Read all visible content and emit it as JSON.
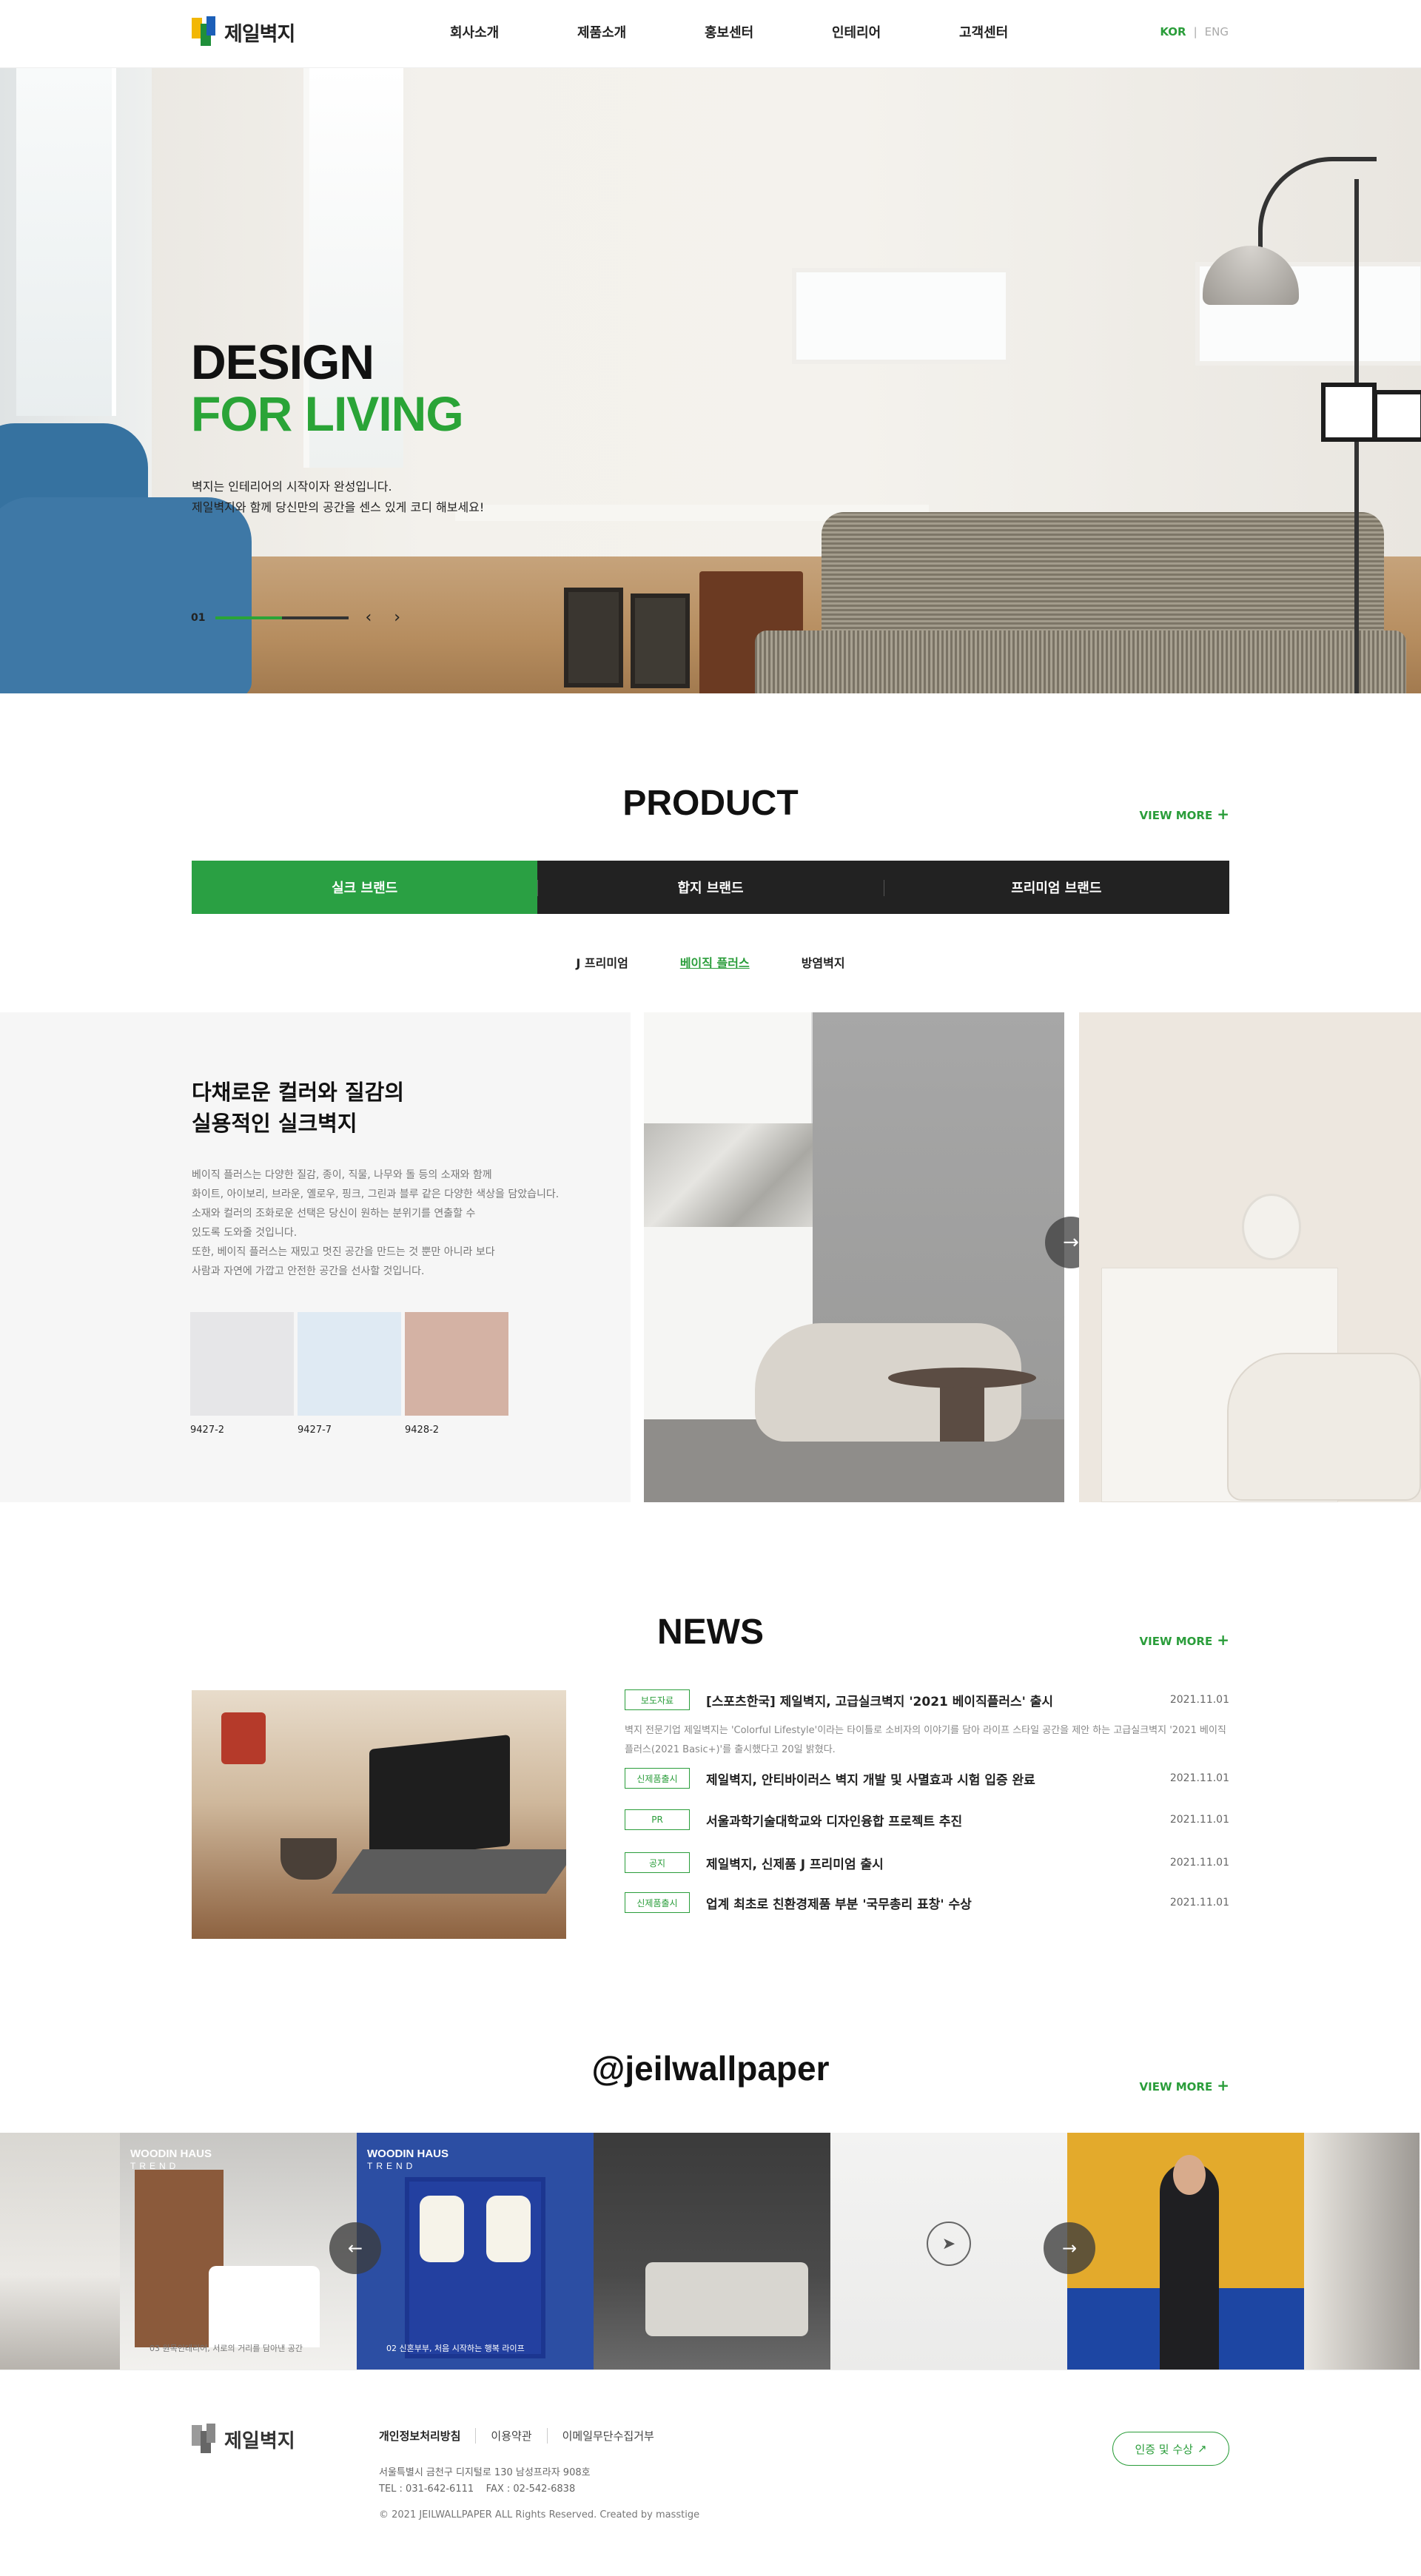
{
  "header": {
    "logo_text": "제일벽지",
    "nav": [
      "회사소개",
      "제품소개",
      "홍보센터",
      "인테리어",
      "고객센터"
    ],
    "lang_active": "KOR",
    "lang_other": "ENG"
  },
  "hero": {
    "title_line1": "DESIGN",
    "title_line2": "FOR LIVING",
    "desc_line1": "벽지는 인테리어의 시작이자 완성입니다.",
    "desc_line2": "제일벽지와 함께 당신만의 공간을 센스 있게 코디 해보세요!",
    "slide_number": "01",
    "progress": 0.5,
    "prev_icon": "‹",
    "next_icon": "›"
  },
  "product": {
    "title": "PRODUCT",
    "view_more": "VIEW MORE",
    "tabs": [
      "실크 브랜드",
      "합지 브랜드",
      "프리미엄 브랜드"
    ],
    "subtabs": [
      "J 프리미엄",
      "베이직 플러스",
      "방염벽지"
    ],
    "heading_line1": "다채로운 컬러와 질감의",
    "heading_line2": "실용적인 실크벽지",
    "desc": [
      "베이직 플러스는 다양한 질감, 종이, 직물, 나무와 돌 등의 소재와 함께",
      "화이트, 아이보리, 브라운, 옐로우, 핑크, 그린과 블루 같은 다양한 색상을 담았습니다.",
      "소재와 컬러의 조화로운 선택은 당신이 원하는 분위기를 연출할 수",
      "있도록 도와줄 것입니다.",
      "또한, 베이직 플러스는 재밌고 멋진 공간을 만드는 것 뿐만 아니라 보다",
      "사람과 자연에 가깝고 안전한 공간을 선사할 것입니다."
    ],
    "swatches": [
      {
        "code": "9427-2",
        "color": "#e6e6e8"
      },
      {
        "code": "9427-7",
        "color": "#dfeaf3"
      },
      {
        "code": "9428-2",
        "color": "#d4b2a4"
      }
    ]
  },
  "news": {
    "title": "NEWS",
    "view_more": "VIEW MORE",
    "items": [
      {
        "badge": "보도자료",
        "title": "[스포츠한국] 제일벽지, 고급실크벽지 '2021 베이직플러스' 출시",
        "date": "2021.11.01"
      },
      {
        "badge": "신제품출시",
        "title": "제일벽지, 안티바이러스 벽지 개발 및 사멸효과 시험 입증 완료",
        "date": "2021.11.01"
      },
      {
        "badge": "PR",
        "title": "서울과학기술대학교와 디자인융합 프로젝트 추진",
        "date": "2021.11.01"
      },
      {
        "badge": "공지",
        "title": "제일벽지, 신제품 J 프리미엄 출시",
        "date": "2021.11.01"
      },
      {
        "badge": "신제품출시",
        "title": "업계 최초로 친환경제품 부분 '국무총리 표창' 수상",
        "date": "2021.11.01"
      }
    ],
    "summary": "벽지 전문기업 제일벽지는 'Colorful Lifestyle'이라는 타이틀로 소비자의 이야기를 담아 라이프 스타일 공간을 제안 하는 고급실크벽지 '2021 베이직플러스(2021 Basic+)'를 출시했다고 20일 밝혔다."
  },
  "instagram": {
    "title": "@jeilwallpaper",
    "view_more": "VIEW MORE",
    "tag_brand": "WOODIN HAUS",
    "tag_sub": "TREND",
    "cap1": "03 원목인테리어, 서로의 거리를 담아낸 공간",
    "cap2": "02 신혼부부, 처음 시작하는 행복 라이프"
  },
  "footer": {
    "logo_text": "제일벽지",
    "links": [
      "개인정보처리방침",
      "이용약관",
      "이메일무단수집거부"
    ],
    "address": "서울특별시 금천구 디지털로 130 남성프라자 908호",
    "tel": "TEL : 031-642-6111",
    "fax": "FAX : 02-542-6838",
    "copyright": "© 2021 JEILWALLPAPER ALL Rights Reserved. Created by masstige",
    "cert_button": "인증 및 수상"
  },
  "colors": {
    "brand_green": "#2aa043",
    "dark": "#222222"
  }
}
